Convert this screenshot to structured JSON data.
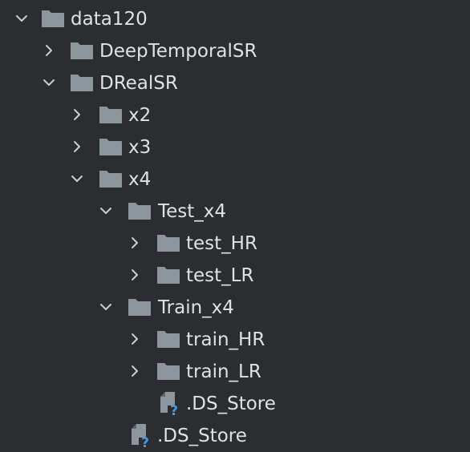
{
  "tree": {
    "root": {
      "label": "data120",
      "state": "expanded",
      "icon": "folder-icon"
    },
    "deeptemporal": {
      "label": "DeepTemporalSR",
      "state": "collapsed",
      "icon": "folder-icon"
    },
    "drealsr": {
      "label": "DRealSR",
      "state": "expanded",
      "icon": "folder-icon"
    },
    "x2": {
      "label": "x2",
      "state": "collapsed",
      "icon": "folder-icon"
    },
    "x3": {
      "label": "x3",
      "state": "collapsed",
      "icon": "folder-icon"
    },
    "x4": {
      "label": "x4",
      "state": "expanded",
      "icon": "folder-icon"
    },
    "test_x4": {
      "label": "Test_x4",
      "state": "expanded",
      "icon": "folder-icon"
    },
    "test_hr": {
      "label": "test_HR",
      "state": "collapsed",
      "icon": "folder-icon"
    },
    "test_lr": {
      "label": "test_LR",
      "state": "collapsed",
      "icon": "folder-icon"
    },
    "train_x4": {
      "label": "Train_x4",
      "state": "expanded",
      "icon": "folder-icon"
    },
    "train_hr": {
      "label": "train_HR",
      "state": "collapsed",
      "icon": "folder-icon"
    },
    "train_lr": {
      "label": "train_LR",
      "state": "collapsed",
      "icon": "folder-icon"
    },
    "train_ds_store": {
      "label": ".DS_Store",
      "icon": "unknown-file-icon"
    },
    "x4_ds_store": {
      "label": ".DS_Store",
      "icon": "unknown-file-icon"
    }
  },
  "colors": {
    "background": "#2b2d30",
    "folder": "#8d969d",
    "text": "#dfe1e5",
    "chevron": "#c9ccd1",
    "question_mark": "#3d9ee6"
  }
}
